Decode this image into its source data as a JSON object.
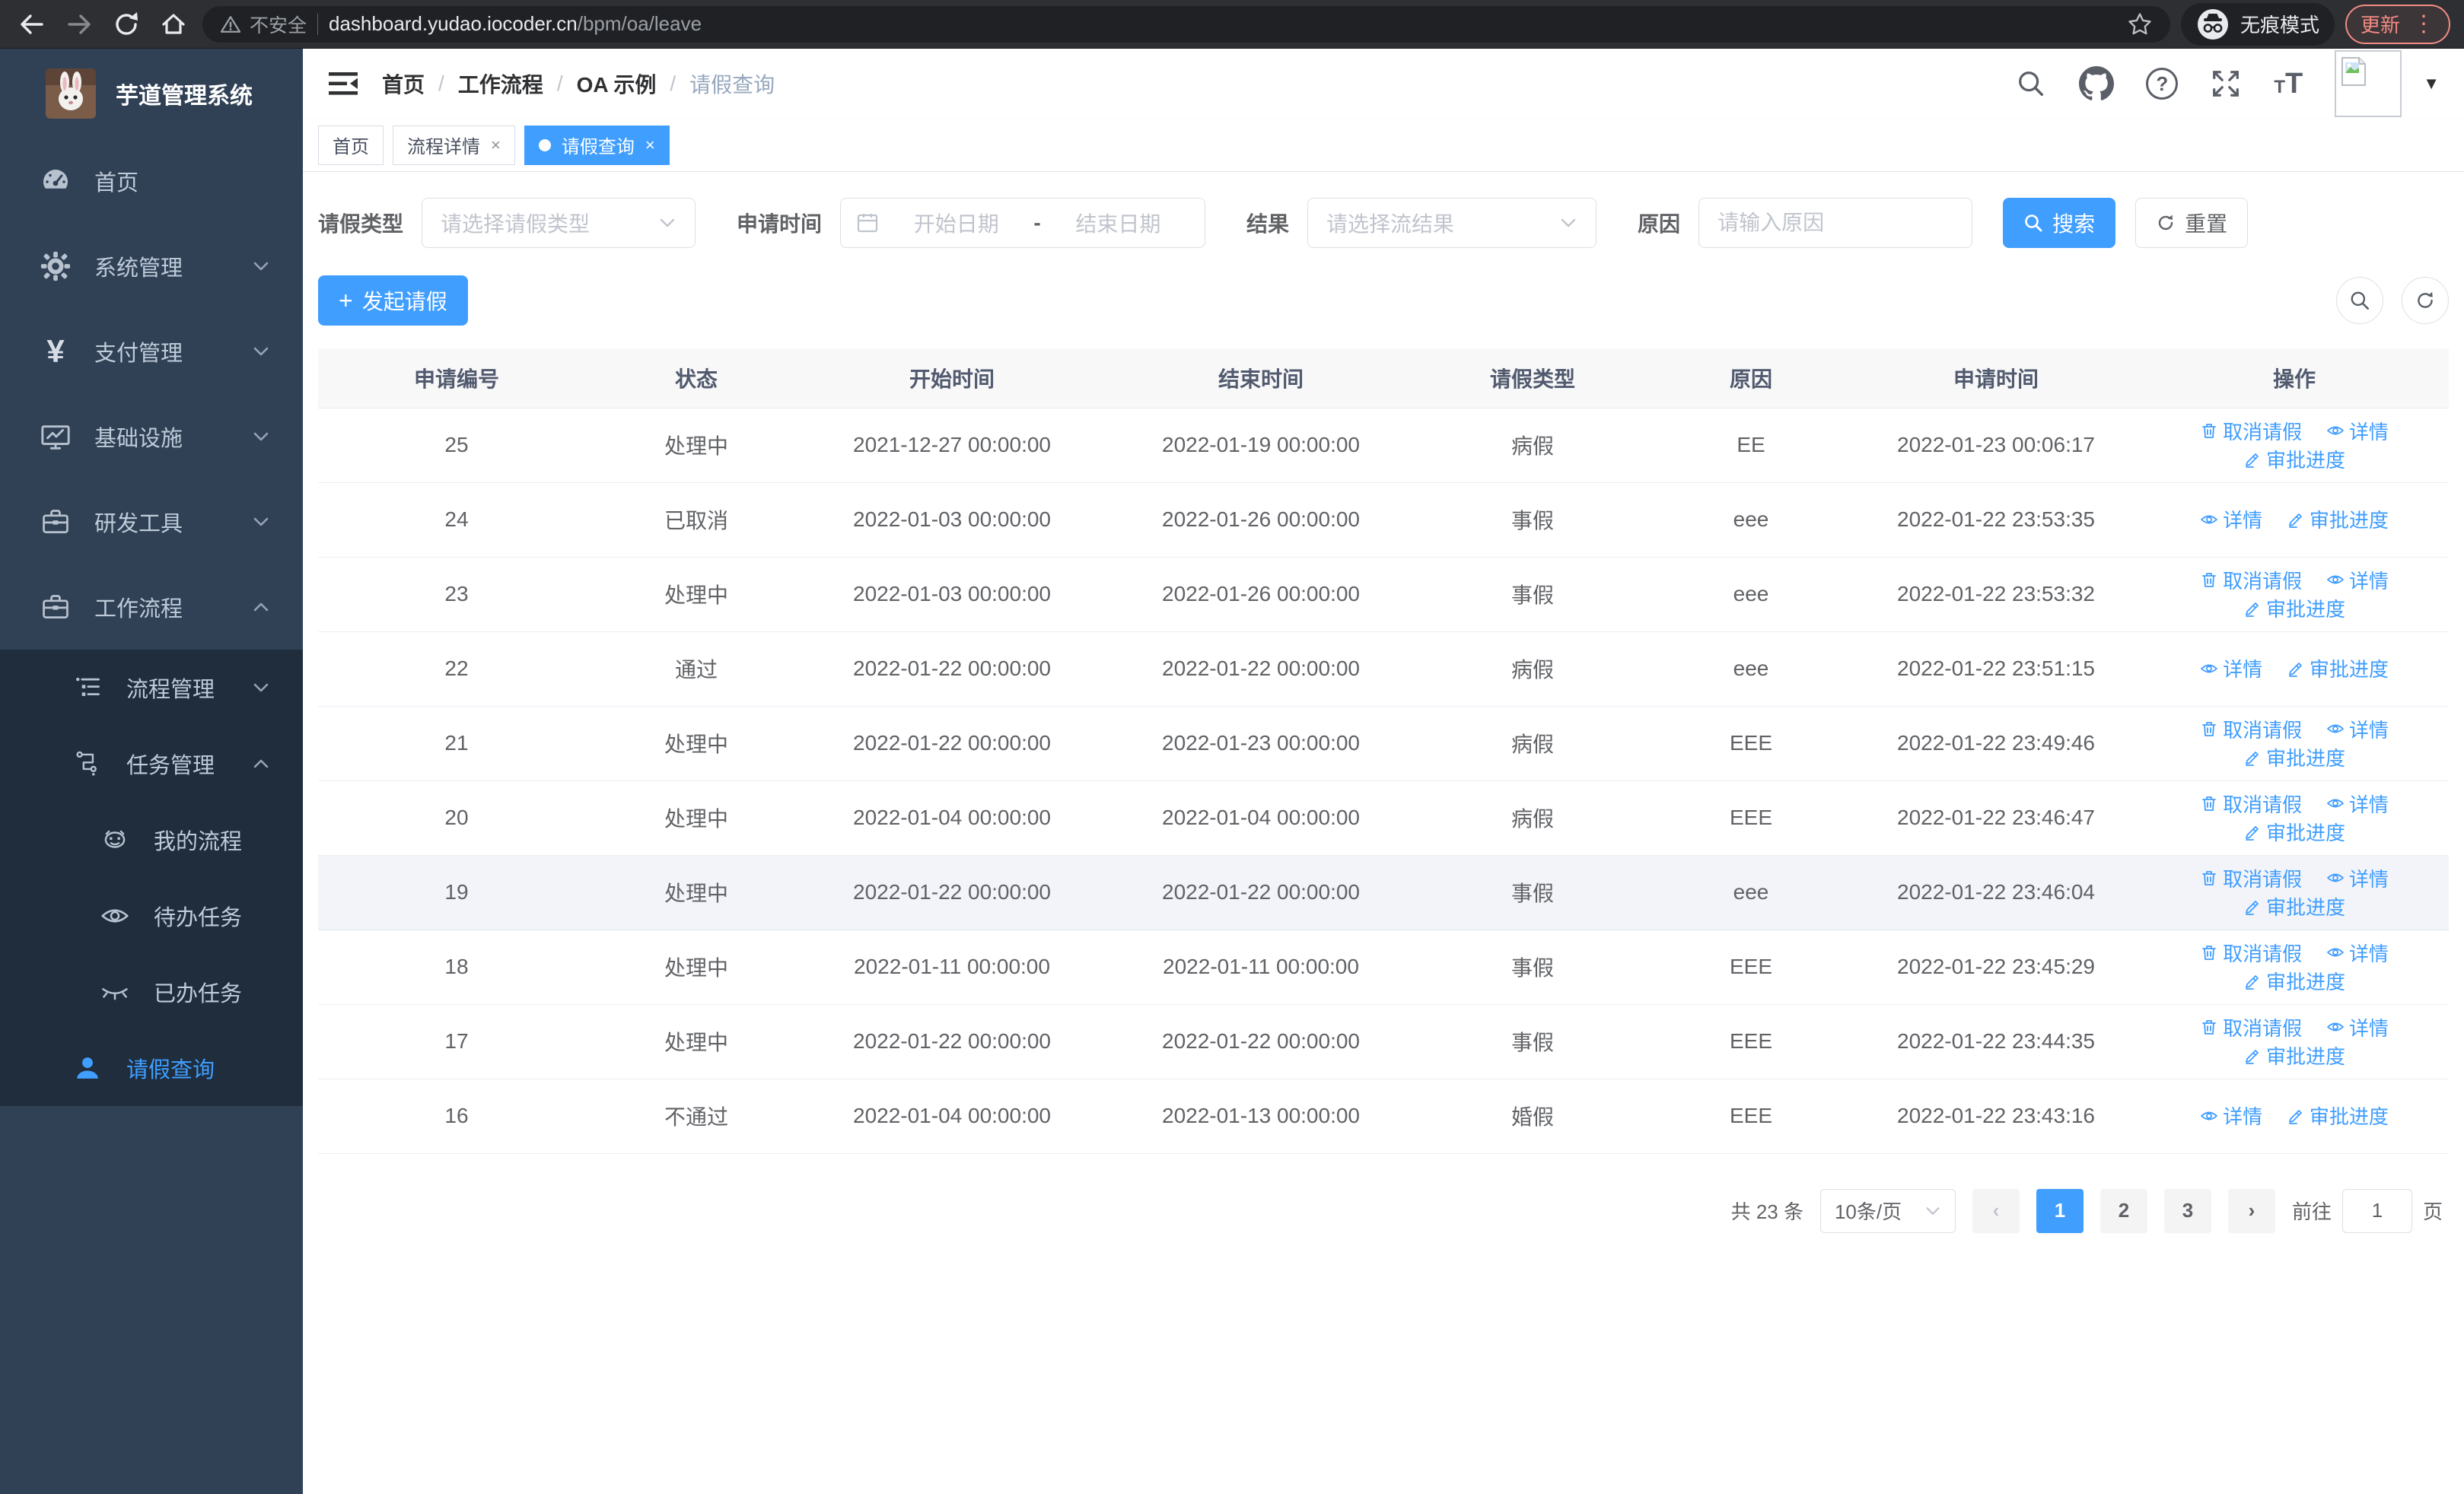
{
  "browser": {
    "security_label": "不安全",
    "url_host": "dashboard.yudao.iocoder.cn",
    "url_path": "/bpm/oa/leave",
    "incognito_label": "无痕模式",
    "update_label": "更新"
  },
  "sidebar": {
    "title": "芋道管理系统",
    "menu": {
      "home": "首页",
      "system": "系统管理",
      "pay": "支付管理",
      "infra": "基础设施",
      "dev": "研发工具",
      "workflow": "工作流程",
      "process_mgmt": "流程管理",
      "task_mgmt": "任务管理",
      "my_process": "我的流程",
      "todo_task": "待办任务",
      "done_task": "已办任务",
      "leave_query": "请假查询"
    }
  },
  "header": {
    "breadcrumb": [
      "首页",
      "工作流程",
      "OA 示例",
      "请假查询"
    ]
  },
  "tabs": [
    {
      "label": "首页"
    },
    {
      "label": "流程详情"
    },
    {
      "label": "请假查询"
    }
  ],
  "filters": {
    "leave_type_label": "请假类型",
    "leave_type_placeholder": "请选择请假类型",
    "apply_time_label": "申请时间",
    "date_start_placeholder": "开始日期",
    "date_separator": "-",
    "date_end_placeholder": "结束日期",
    "result_label": "结果",
    "result_placeholder": "请选择流结果",
    "reason_label": "原因",
    "reason_placeholder": "请输入原因",
    "search_label": "搜索",
    "reset_label": "重置"
  },
  "toolbar": {
    "create_label": "发起请假"
  },
  "table": {
    "columns": [
      "申请编号",
      "状态",
      "开始时间",
      "结束时间",
      "请假类型",
      "原因",
      "申请时间",
      "操作"
    ],
    "action_labels": {
      "cancel": "取消请假",
      "detail": "详情",
      "progress": "审批进度"
    },
    "rows": [
      {
        "id": "25",
        "status": "处理中",
        "start": "2021-12-27 00:00:00",
        "end": "2022-01-19 00:00:00",
        "type": "病假",
        "reason": "EE",
        "apply_time": "2022-01-23 00:06:17",
        "actions": [
          "cancel",
          "detail",
          "progress"
        ]
      },
      {
        "id": "24",
        "status": "已取消",
        "start": "2022-01-03 00:00:00",
        "end": "2022-01-26 00:00:00",
        "type": "事假",
        "reason": "eee",
        "apply_time": "2022-01-22 23:53:35",
        "actions": [
          "detail",
          "progress"
        ]
      },
      {
        "id": "23",
        "status": "处理中",
        "start": "2022-01-03 00:00:00",
        "end": "2022-01-26 00:00:00",
        "type": "事假",
        "reason": "eee",
        "apply_time": "2022-01-22 23:53:32",
        "actions": [
          "cancel",
          "detail",
          "progress"
        ]
      },
      {
        "id": "22",
        "status": "通过",
        "start": "2022-01-22 00:00:00",
        "end": "2022-01-22 00:00:00",
        "type": "病假",
        "reason": "eee",
        "apply_time": "2022-01-22 23:51:15",
        "actions": [
          "detail",
          "progress"
        ]
      },
      {
        "id": "21",
        "status": "处理中",
        "start": "2022-01-22 00:00:00",
        "end": "2022-01-23 00:00:00",
        "type": "病假",
        "reason": "EEE",
        "apply_time": "2022-01-22 23:49:46",
        "actions": [
          "cancel",
          "detail",
          "progress"
        ]
      },
      {
        "id": "20",
        "status": "处理中",
        "start": "2022-01-04 00:00:00",
        "end": "2022-01-04 00:00:00",
        "type": "病假",
        "reason": "EEE",
        "apply_time": "2022-01-22 23:46:47",
        "actions": [
          "cancel",
          "detail",
          "progress"
        ]
      },
      {
        "id": "19",
        "status": "处理中",
        "start": "2022-01-22 00:00:00",
        "end": "2022-01-22 00:00:00",
        "type": "事假",
        "reason": "eee",
        "apply_time": "2022-01-22 23:46:04",
        "actions": [
          "cancel",
          "detail",
          "progress"
        ],
        "highlighted": true
      },
      {
        "id": "18",
        "status": "处理中",
        "start": "2022-01-11 00:00:00",
        "end": "2022-01-11 00:00:00",
        "type": "事假",
        "reason": "EEE",
        "apply_time": "2022-01-22 23:45:29",
        "actions": [
          "cancel",
          "detail",
          "progress"
        ]
      },
      {
        "id": "17",
        "status": "处理中",
        "start": "2022-01-22 00:00:00",
        "end": "2022-01-22 00:00:00",
        "type": "事假",
        "reason": "EEE",
        "apply_time": "2022-01-22 23:44:35",
        "actions": [
          "cancel",
          "detail",
          "progress"
        ]
      },
      {
        "id": "16",
        "status": "不通过",
        "start": "2022-01-04 00:00:00",
        "end": "2022-01-13 00:00:00",
        "type": "婚假",
        "reason": "EEE",
        "apply_time": "2022-01-22 23:43:16",
        "actions": [
          "detail",
          "progress"
        ]
      }
    ]
  },
  "pagination": {
    "total_text": "共 23 条",
    "page_size_text": "10条/页",
    "pages": [
      "1",
      "2",
      "3"
    ],
    "active_page": "1",
    "goto_label": "前往",
    "goto_value": "1",
    "goto_suffix": "页"
  },
  "icons": {
    "search": "magnifier",
    "github": "octocat-mark",
    "help": "question-circle",
    "fullscreen": "expand-arrows",
    "font_size": "double-T",
    "refresh": "circular-arrows",
    "calendar": "calendar-grid",
    "plus": "plus-sign",
    "trash": "trash-can",
    "eye": "eye-open",
    "pen": "edit-pen",
    "incognito": "hat-and-glasses",
    "broken_image": "broken-image-page"
  },
  "colors": {
    "primary": "#409eff",
    "sidebar_bg": "#304156",
    "sidebar_submenu_bg": "#1f2d3d",
    "chrome_bg": "#2e2f33",
    "update_red": "#f28b82",
    "table_header_bg": "#f8f8f9",
    "highlight_row_bg": "#f2f4f9"
  }
}
